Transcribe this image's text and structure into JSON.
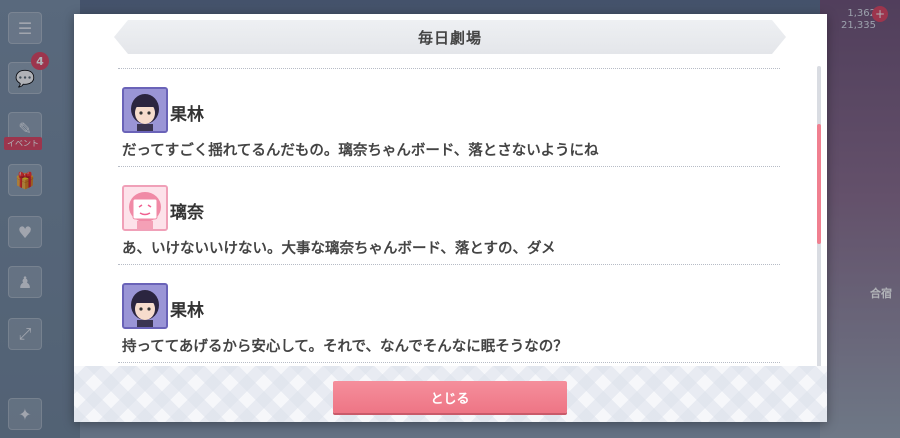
{
  "title": "毎日劇場",
  "close_button": "とじる",
  "entries": [
    {
      "speaker": "果林",
      "avatar": "karin-avatar",
      "text": "だってすごく揺れてるんだもの。璃奈ちゃんボード、落とさないようにね"
    },
    {
      "speaker": "璃奈",
      "avatar": "rina-avatar",
      "text": "あ、いけないいけない。大事な璃奈ちゃんボード、落とすの、ダメ"
    },
    {
      "speaker": "果林",
      "avatar": "karin-avatar",
      "text": "持っててあげるから安心して。それで、なんでそんなに眠そうなの？"
    }
  ],
  "sidebar": {
    "badge_count": "4",
    "event_label": "イベント"
  },
  "header_right": {
    "value1": "1,362",
    "value2": "21,335"
  },
  "right_label": "合宿",
  "scroll_position": 0.3,
  "colors": {
    "accent": "#ee7585",
    "scroll_thumb": "#f08090",
    "avatar_karin_border": "#6a63b8",
    "avatar_rina_border": "#f0a0b8"
  }
}
